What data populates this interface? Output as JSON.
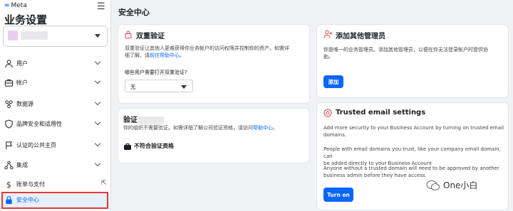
{
  "brand": {
    "logo_text": "Meta",
    "menu_icon": "hamburger-icon"
  },
  "sidebar": {
    "title": "业务设置",
    "items": [
      {
        "label": "用户",
        "icon": "person-icon",
        "chevron": true
      },
      {
        "label": "帐户",
        "icon": "briefcase-icon",
        "chevron": true
      },
      {
        "label": "数据源",
        "icon": "data-sources-icon",
        "chevron": true
      },
      {
        "label": "品牌安全和适用性",
        "icon": "shield-icon",
        "chevron": true
      },
      {
        "label": "认证的公共主页",
        "icon": "flag-icon",
        "chevron": true
      },
      {
        "label": "集成",
        "icon": "integrations-icon",
        "chevron": true
      },
      {
        "label": "账单与支付",
        "icon": "dollar-icon",
        "external": true
      },
      {
        "label": "安全中心",
        "icon": "lock-icon",
        "active": true
      }
    ]
  },
  "main": {
    "title": "安全中心",
    "two_factor": {
      "title": "双重验证",
      "desc_line1": "双重验证让其他人更难获得你业务帐户的访问权限并控制你的资产。如需详",
      "desc_line2_prefix": "细了解，请",
      "desc_link": "前往帮助中心",
      "desc_line2_suffix": "。",
      "question": "哪些用户需要打开双重验证?",
      "select_value": "无"
    },
    "verification": {
      "title_prefix": "验证",
      "desc_prefix": "你的组织不需要验证。如需详细了解公司验证资格，请访问",
      "desc_link": "帮助中心",
      "desc_suffix": "。",
      "status": "不符合验证资格"
    },
    "admins": {
      "title": "添加其他管理员",
      "desc_line1": "你是唯一的业务管理员。添加其他管理员，以便在你无法登录帐户时提供协",
      "desc_line2": "助。",
      "button": "添加"
    },
    "email": {
      "title": "Trusted email settings",
      "p1_line1": "Add more security to your Business Account by turning on trusted email",
      "p1_line2": "domains.",
      "p2_line1": "People with email domains you trust, like your company email domain, can",
      "p2_line2": "be added directly to your Business Account",
      "p3_line1": "Anyone without a trusted domain will need to be approved by another",
      "p3_line2": "business admin before they have access.",
      "button": "Turn on"
    }
  },
  "watermark": {
    "text": "One小白"
  },
  "colors": {
    "accent": "#0866ff",
    "highlight": "#e53935",
    "active_bg": "#e7f0fe",
    "email_icon": "#e0464b"
  }
}
